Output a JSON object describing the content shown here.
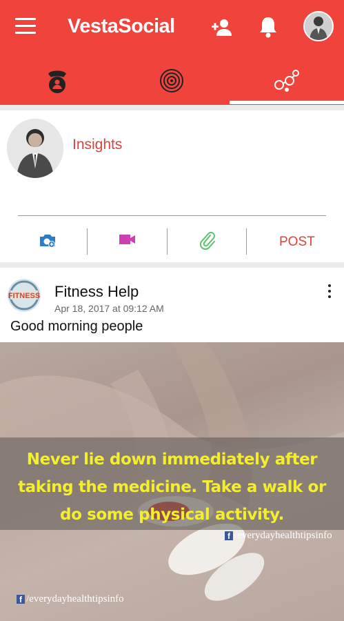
{
  "app": {
    "title": "VestaSocial"
  },
  "tabs": [
    {
      "icon": "phone-contact-icon",
      "active": false
    },
    {
      "icon": "target-rings-icon",
      "active": false
    },
    {
      "icon": "social-network-icon",
      "active": true
    }
  ],
  "composer": {
    "prompt_label": "Insights",
    "actions": [
      "camera-add-icon",
      "video-icon",
      "attach-icon"
    ],
    "post_label": "POST"
  },
  "post": {
    "author": "Fitness Help",
    "date": "Apr 18, 2017 at 09:12 AM",
    "text": "Good morning people",
    "image": {
      "caption_lines": [
        "Never lie down immediately after",
        "taking the medicine. Take a walk or",
        "do some physical activity."
      ],
      "credit": "/everydayhealthtipsinfo"
    }
  },
  "colors": {
    "brand": "#f0433b",
    "accent": "#e0403a",
    "caption": "#f4ef2e"
  }
}
